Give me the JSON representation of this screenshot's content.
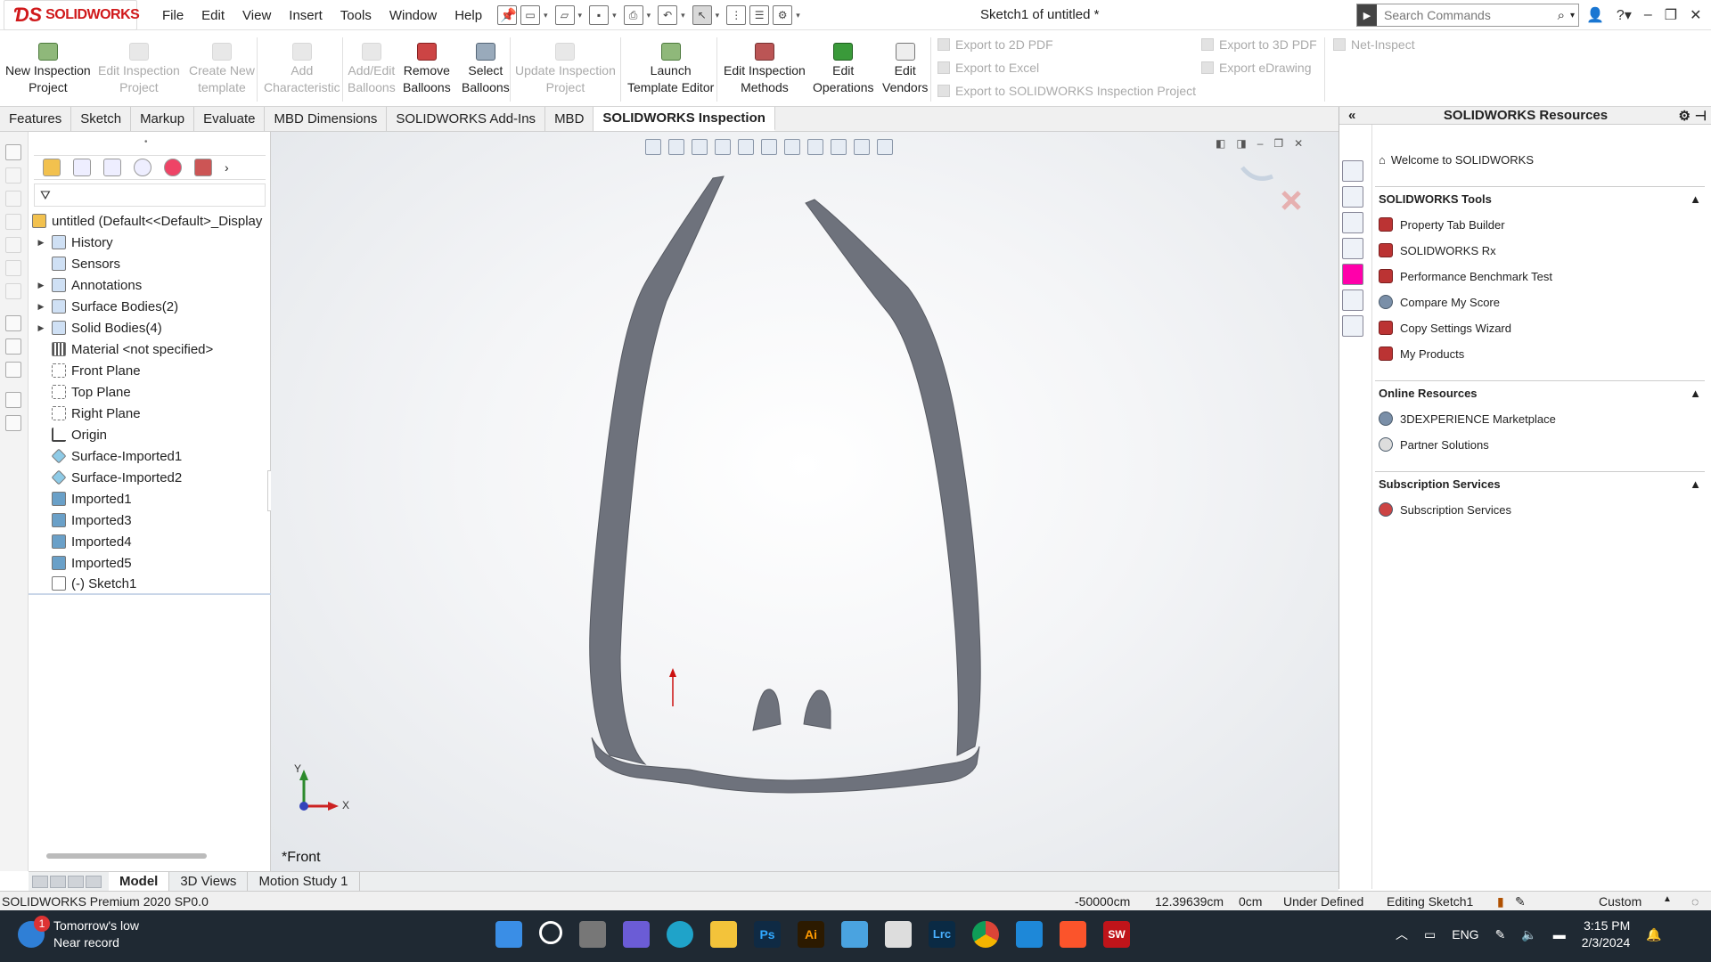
{
  "app": {
    "logo_text": "SOLIDWORKS",
    "document_title": "Sketch1 of untitled *",
    "search_placeholder": "Search Commands"
  },
  "menu": [
    "File",
    "Edit",
    "View",
    "Insert",
    "Tools",
    "Window",
    "Help"
  ],
  "ribbon": {
    "buttons": [
      {
        "line1": "New Inspection",
        "line2": "Project",
        "enabled": true
      },
      {
        "line1": "Edit Inspection",
        "line2": "Project",
        "enabled": false
      },
      {
        "line1": "Create New",
        "line2": "template",
        "enabled": false
      },
      {
        "line1": "Add",
        "line2": "Characteristic",
        "enabled": false
      },
      {
        "line1": "Add/Edit",
        "line2": "Balloons",
        "enabled": false
      },
      {
        "line1": "Remove",
        "line2": "Balloons",
        "enabled": true
      },
      {
        "line1": "Select",
        "line2": "Balloons",
        "enabled": true
      },
      {
        "line1": "Update Inspection",
        "line2": "Project",
        "enabled": false
      },
      {
        "line1": "Launch",
        "line2": "Template Editor",
        "enabled": true
      },
      {
        "line1": "Edit Inspection",
        "line2": "Methods",
        "enabled": true
      },
      {
        "line1": "Edit",
        "line2": "Operations",
        "enabled": true
      },
      {
        "line1": "Edit",
        "line2": "Vendors",
        "enabled": true
      }
    ],
    "export_items": [
      "Export to 2D PDF",
      "Export to Excel",
      "Export to SOLIDWORKS Inspection Project",
      "Export to 3D PDF",
      "Export eDrawing",
      "Net-Inspect"
    ]
  },
  "tabs": [
    "Features",
    "Sketch",
    "Markup",
    "Evaluate",
    "MBD Dimensions",
    "SOLIDWORKS Add-Ins",
    "MBD",
    "SOLIDWORKS Inspection"
  ],
  "active_tab": "SOLIDWORKS Inspection",
  "tree": {
    "root": "untitled  (Default<<Default>_Display",
    "items": [
      {
        "label": "History",
        "expandable": true,
        "icon": "folder"
      },
      {
        "label": "Sensors",
        "expandable": false,
        "icon": "folder"
      },
      {
        "label": "Annotations",
        "expandable": true,
        "icon": "folder"
      },
      {
        "label": "Surface Bodies(2)",
        "expandable": true,
        "icon": "folder"
      },
      {
        "label": "Solid Bodies(4)",
        "expandable": true,
        "icon": "folder"
      },
      {
        "label": "Material <not specified>",
        "expandable": false,
        "icon": "material"
      },
      {
        "label": "Front Plane",
        "expandable": false,
        "icon": "plane"
      },
      {
        "label": "Top Plane",
        "expandable": false,
        "icon": "plane"
      },
      {
        "label": "Right Plane",
        "expandable": false,
        "icon": "plane"
      },
      {
        "label": "Origin",
        "expandable": false,
        "icon": "origin"
      },
      {
        "label": "Surface-Imported1",
        "expandable": false,
        "icon": "surf"
      },
      {
        "label": "Surface-Imported2",
        "expandable": false,
        "icon": "surf"
      },
      {
        "label": "Imported1",
        "expandable": false,
        "icon": "body"
      },
      {
        "label": "Imported3",
        "expandable": false,
        "icon": "body"
      },
      {
        "label": "Imported4",
        "expandable": false,
        "icon": "body"
      },
      {
        "label": "Imported5",
        "expandable": false,
        "icon": "body"
      },
      {
        "label": "(-) Sketch1",
        "expandable": false,
        "icon": "sketch"
      }
    ]
  },
  "viewport": {
    "view_name": "*Front",
    "triad_x": "X",
    "triad_y": "Y"
  },
  "bottom_tabs": [
    "Model",
    "3D Views",
    "Motion Study 1"
  ],
  "bottom_active": "Model",
  "taskpane": {
    "title": "SOLIDWORKS Resources",
    "welcome": "Welcome to SOLIDWORKS",
    "sections": [
      {
        "title": "SOLIDWORKS Tools",
        "items": [
          "Property Tab Builder",
          "SOLIDWORKS Rx",
          "Performance Benchmark Test",
          "Compare My Score",
          "Copy Settings Wizard",
          "My Products"
        ]
      },
      {
        "title": "Online Resources",
        "items": [
          "3DEXPERIENCE Marketplace",
          "Partner Solutions"
        ]
      },
      {
        "title": "Subscription Services",
        "items": [
          "Subscription Services"
        ]
      }
    ]
  },
  "status": {
    "product": "SOLIDWORKS Premium 2020 SP0.0",
    "x": "-50000cm",
    "y": "12.39639cm",
    "z": "0cm",
    "state": "Under Defined",
    "editing": "Editing Sketch1",
    "units": "Custom"
  },
  "taskbar": {
    "weather_title": "Tomorrow's low",
    "weather_sub": "Near record",
    "weather_badge": "1",
    "lang": "ENG",
    "time": "3:15 PM",
    "date": "2/3/2024"
  },
  "colors": {
    "brand_red": "#d0191b",
    "model_gray": "#6e727c",
    "taskbar_bg": "#1f2933"
  }
}
